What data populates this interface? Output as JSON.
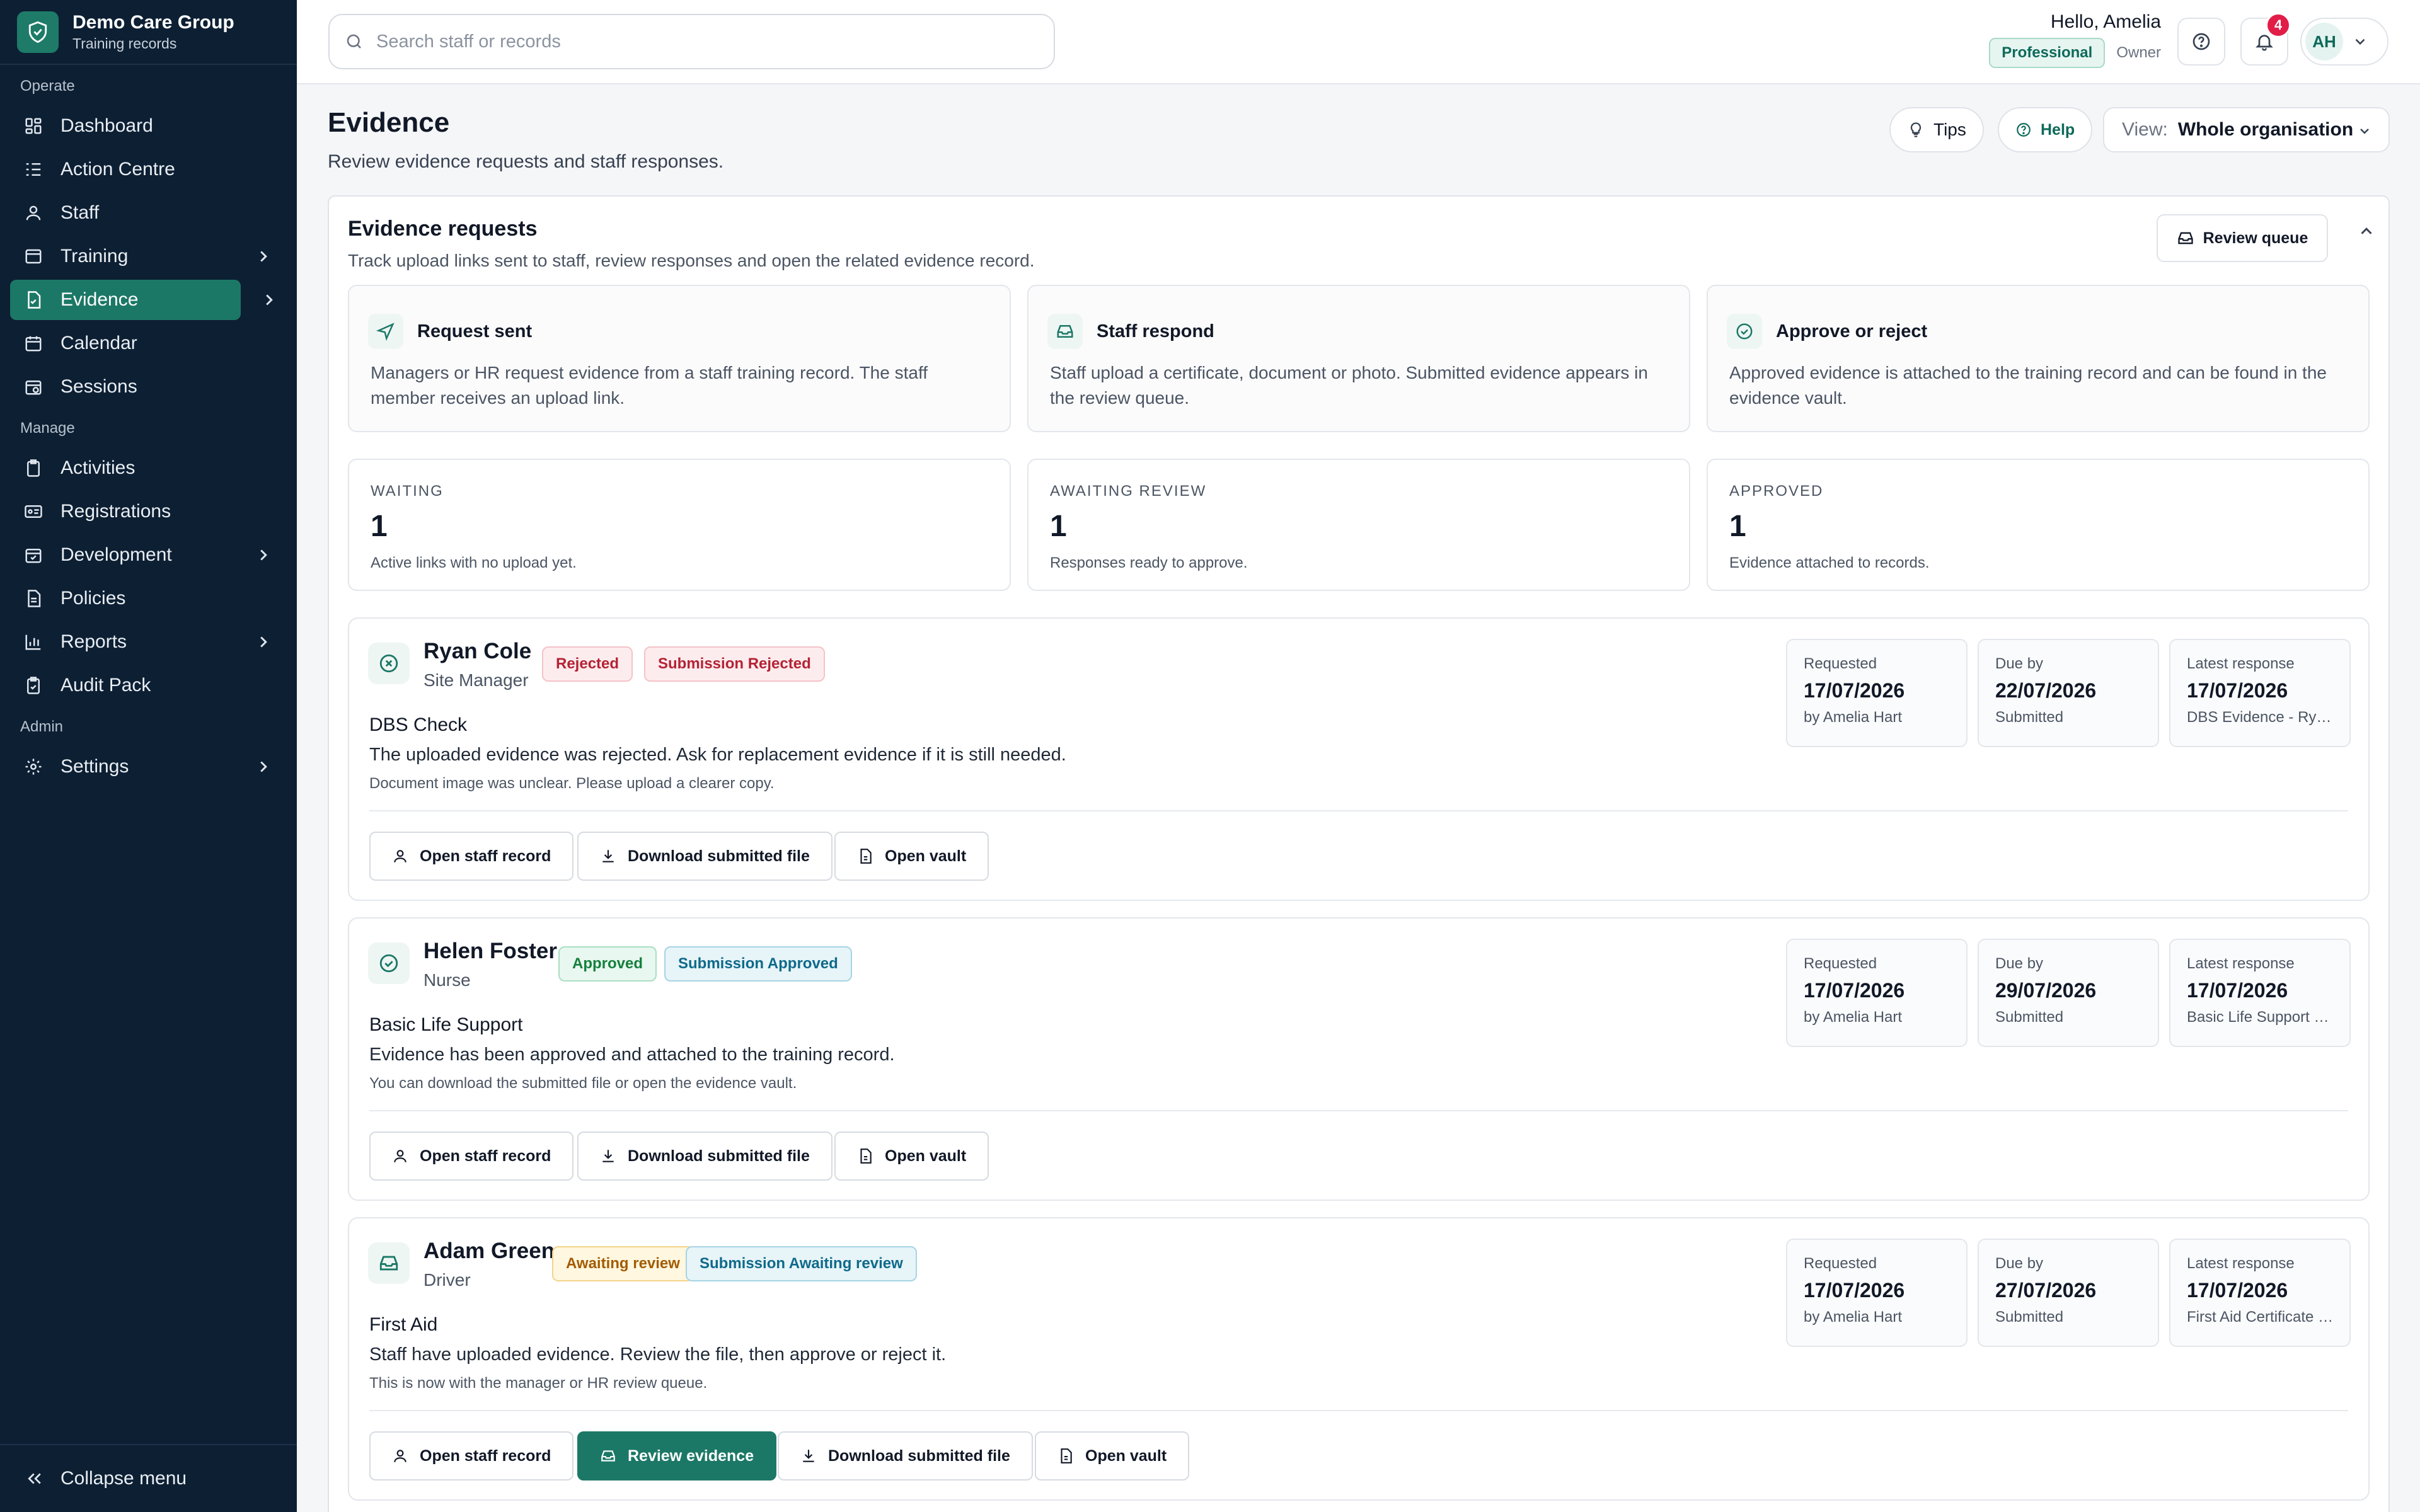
{
  "brand": {
    "name": "Demo Care Group",
    "subtitle": "Training records"
  },
  "sidebar": {
    "sections": {
      "operate": "Operate",
      "manage": "Manage",
      "admin": "Admin"
    },
    "items": {
      "dashboard": "Dashboard",
      "action_centre": "Action Centre",
      "staff": "Staff",
      "training": "Training",
      "evidence": "Evidence",
      "calendar": "Calendar",
      "sessions": "Sessions",
      "activities": "Activities",
      "registrations": "Registrations",
      "development": "Development",
      "policies": "Policies",
      "reports": "Reports",
      "audit_pack": "Audit Pack",
      "settings": "Settings"
    },
    "active": "Evidence",
    "collapse_label": "Collapse menu"
  },
  "topbar": {
    "search_placeholder": "Search staff or records",
    "greeting": "Hello, Amelia",
    "plan": "Professional",
    "role": "Owner",
    "notification_count": "4",
    "avatar_initials": "AH"
  },
  "page": {
    "title": "Evidence",
    "subtitle": "Review evidence requests and staff responses.",
    "tips_label": "Tips",
    "help_label": "Help",
    "view_label": "View:",
    "view_value": "Whole organisation"
  },
  "panel": {
    "title": "Evidence requests",
    "subtitle": "Track upload links sent to staff, review responses and open the related evidence record.",
    "review_queue_label": "Review queue",
    "steps": [
      {
        "title": "Request sent",
        "body": "Managers or HR request evidence from a staff training record. The staff member receives an upload link."
      },
      {
        "title": "Staff respond",
        "body": "Staff upload a certificate, document or photo. Submitted evidence appears in the review queue."
      },
      {
        "title": "Approve or reject",
        "body": "Approved evidence is attached to the training record and can be found in the evidence vault."
      }
    ],
    "stats": [
      {
        "label": "WAITING",
        "value": "1",
        "note": "Active links with no upload yet."
      },
      {
        "label": "AWAITING REVIEW",
        "value": "1",
        "note": "Responses ready to approve."
      },
      {
        "label": "APPROVED",
        "value": "1",
        "note": "Evidence attached to records."
      }
    ]
  },
  "requests": [
    {
      "name": "Ryan Cole",
      "role": "Site Manager",
      "status": "Rejected",
      "submission_status": "Submission Rejected",
      "course": "DBS Check",
      "message": "The uploaded evidence was rejected. Ask for replacement evidence if it is still needed.",
      "note": "Document image was unclear. Please upload a clearer copy.",
      "requested_label": "Requested",
      "requested_date": "17/07/2026",
      "requested_by": "by Amelia Hart",
      "due_label": "Due by",
      "due_date": "22/07/2026",
      "due_sub": "Submitted",
      "latest_label": "Latest response",
      "latest_date": "17/07/2026",
      "latest_sub": "DBS Evidence - Ryan Cole",
      "buttons": {
        "staff_record": "Open staff record",
        "download": "Download submitted file",
        "vault": "Open vault"
      }
    },
    {
      "name": "Helen Foster",
      "role": "Nurse",
      "status": "Approved",
      "submission_status": "Submission Approved",
      "course": "Basic Life Support",
      "message": "Evidence has been approved and attached to the training record.",
      "note": "You can download the submitted file or open the evidence vault.",
      "requested_label": "Requested",
      "requested_date": "17/07/2026",
      "requested_by": "by Amelia Hart",
      "due_label": "Due by",
      "due_date": "29/07/2026",
      "due_sub": "Submitted",
      "latest_label": "Latest response",
      "latest_date": "17/07/2026",
      "latest_sub": "Basic Life Support Evidence",
      "buttons": {
        "staff_record": "Open staff record",
        "download": "Download submitted file",
        "vault": "Open vault"
      }
    },
    {
      "name": "Adam Green",
      "role": "Driver",
      "status": "Awaiting review",
      "submission_status": "Submission Awaiting review",
      "course": "First Aid",
      "message": "Staff have uploaded evidence. Review the file, then approve or reject it.",
      "note": "This is now with the manager or HR review queue.",
      "requested_label": "Requested",
      "requested_date": "17/07/2026",
      "requested_by": "by Amelia Hart",
      "due_label": "Due by",
      "due_date": "27/07/2026",
      "due_sub": "Submitted",
      "latest_label": "Latest response",
      "latest_date": "17/07/2026",
      "latest_sub": "First Aid Certificate - Adam Green",
      "buttons": {
        "staff_record": "Open staff record",
        "review": "Review evidence",
        "download": "Download submitted file",
        "vault": "Open vault"
      }
    }
  ],
  "colors": {
    "sidebar_bg": "#0d1f33",
    "accent": "#1c7866",
    "danger": "#b42334",
    "success": "#15803d"
  }
}
